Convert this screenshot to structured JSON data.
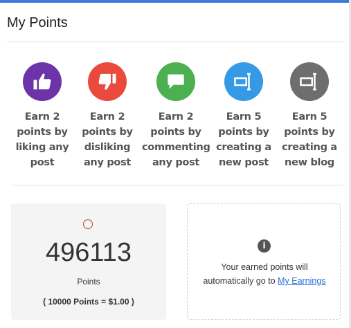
{
  "header": {
    "title": "My Points"
  },
  "colors": {
    "accent": "#3b7dd8",
    "like": "#6c34a8",
    "dislike": "#ea4a3c",
    "comment": "#4caf50",
    "post": "#3699e6",
    "blog": "#6e6e6e",
    "link": "#2a6fd6"
  },
  "actions": [
    {
      "icon": "thumbs-up-icon",
      "line1": "Earn 2",
      "line2": "points by",
      "line3": "liking any",
      "line4": "post"
    },
    {
      "icon": "thumbs-down-icon",
      "line1": "Earn 2",
      "line2": "points by",
      "line3": "disliking",
      "line4": "any post"
    },
    {
      "icon": "comment-icon",
      "line1": "Earn 2",
      "line2": "points by",
      "line3": "commenting",
      "line4": "any post"
    },
    {
      "icon": "text-cursor-icon",
      "line1": "Earn 5",
      "line2": "points by",
      "line3": "creating a",
      "line4": "new post"
    },
    {
      "icon": "text-cursor-icon",
      "line1": "Earn 5",
      "line2": "points by",
      "line3": "creating a",
      "line4": "new blog"
    }
  ],
  "points": {
    "value": "496113",
    "unit": "Points",
    "rate": "( 10000 Points = $1.00 )"
  },
  "info": {
    "icon": "info-icon",
    "glyph": "i",
    "message_line1": "Your earned points will",
    "message_line2_prefix": "automatically go to ",
    "link_label": "My Earnings"
  }
}
